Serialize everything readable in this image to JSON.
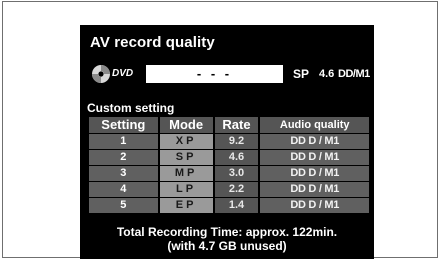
{
  "screen": {
    "title": "AV record quality",
    "disc": {
      "icon": "dvd-disc-icon",
      "label": "DVD",
      "title_value": "- - -",
      "mode": "SP",
      "rate": "4.6",
      "audio": "DD/M1"
    },
    "custom_label": "Custom setting",
    "table": {
      "headers": [
        "Setting",
        "Mode",
        "Rate",
        "Audio quality"
      ],
      "rows": [
        {
          "setting": "1",
          "mode": "XP",
          "rate": "9.2",
          "audio": "DD D / M1"
        },
        {
          "setting": "2",
          "mode": "SP",
          "rate": "4.6",
          "audio": "DD D / M1"
        },
        {
          "setting": "3",
          "mode": "MP",
          "rate": "3.0",
          "audio": "DD D / M1"
        },
        {
          "setting": "4",
          "mode": "LP",
          "rate": "2.2",
          "audio": "DD D / M1"
        },
        {
          "setting": "5",
          "mode": "EP",
          "rate": "1.4",
          "audio": "DD D / M1"
        }
      ]
    },
    "footer": {
      "line1": "Total Recording Time: approx. 122min.",
      "line2": "(with 4.7 GB unused)"
    }
  }
}
